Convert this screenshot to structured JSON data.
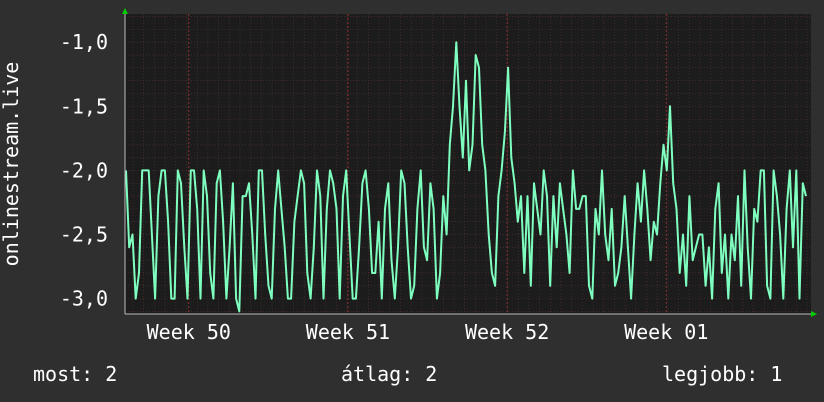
{
  "chart_data": {
    "type": "line",
    "ylabel": "onlinestream.live",
    "ylim": [
      -3.12,
      -0.78
    ],
    "yticks": [
      -1.0,
      -1.5,
      -2.0,
      -2.5,
      -3.0
    ],
    "ytick_labels": [
      "-1,0",
      "-1,5",
      "-2,0",
      "-2,5",
      "-3,0"
    ],
    "xtick_labels": [
      "Week 50",
      "Week 51",
      "Week 52",
      "Week 01"
    ],
    "xtick_positions": [
      0.093,
      0.325,
      0.557,
      0.789
    ],
    "grid": true,
    "colors": {
      "line": "#7fffbf",
      "background": "#2f2f2f",
      "plot_bg": "#1c1c1c",
      "grid": "#553333",
      "arrow": "#00cc00",
      "text": "#ffffff"
    },
    "series": [
      {
        "values": [
          -2,
          -2.6,
          -2.5,
          -3,
          -2.8,
          -2,
          -2,
          -2,
          -2.5,
          -3,
          -2.2,
          -2,
          -2,
          -2.4,
          -3,
          -3,
          -2,
          -2.1,
          -2.6,
          -3,
          -2,
          -2,
          -2.3,
          -3,
          -2,
          -2.2,
          -2.8,
          -3,
          -2.1,
          -2,
          -2.4,
          -3,
          -2.6,
          -2.1,
          -3,
          -3.1,
          -2.2,
          -2.2,
          -2.1,
          -2.5,
          -3,
          -2,
          -2,
          -2.5,
          -2.9,
          -3,
          -2.3,
          -2,
          -2.3,
          -2.6,
          -3,
          -3,
          -2.4,
          -2.2,
          -2,
          -2.1,
          -2.8,
          -3,
          -2.6,
          -2,
          -2.2,
          -3,
          -2.3,
          -2,
          -2.1,
          -2.3,
          -3,
          -2.2,
          -2,
          -2.5,
          -3,
          -3,
          -2.6,
          -2.1,
          -2,
          -2.3,
          -2.8,
          -2.8,
          -2.4,
          -3,
          -2.3,
          -2.1,
          -2.7,
          -3,
          -2.6,
          -2,
          -2.1,
          -2.6,
          -3,
          -2.9,
          -2.3,
          -2.0,
          -2.6,
          -2.7,
          -2.1,
          -2.3,
          -3,
          -2.8,
          -2.2,
          -2.5,
          -1.8,
          -1.5,
          -1.0,
          -1.5,
          -1.9,
          -1.3,
          -2.0,
          -1.8,
          -1.1,
          -1.2,
          -1.8,
          -2.0,
          -2.5,
          -2.8,
          -2.9,
          -2.2,
          -2,
          -1.7,
          -1.2,
          -1.9,
          -2.1,
          -2.4,
          -2.2,
          -2.8,
          -2.2,
          -2.9,
          -2.1,
          -2.3,
          -2.5,
          -2,
          -2.2,
          -2.9,
          -2.2,
          -2.6,
          -2.1,
          -2.3,
          -2.5,
          -2.8,
          -2,
          -2.3,
          -2.3,
          -2.2,
          -2.2,
          -2.9,
          -3,
          -2.3,
          -2.5,
          -2,
          -2.5,
          -2.7,
          -2.3,
          -2.9,
          -2.8,
          -2.6,
          -2.2,
          -2.6,
          -3,
          -2.5,
          -2.1,
          -2.4,
          -2,
          -2.3,
          -2.7,
          -2.4,
          -2.5,
          -2.1,
          -1.8,
          -2,
          -1.5,
          -2.1,
          -2.3,
          -2.8,
          -2.5,
          -2.9,
          -2.2,
          -2.7,
          -2.6,
          -2.5,
          -2.5,
          -2.9,
          -2.6,
          -3,
          -2.3,
          -2.1,
          -2.8,
          -2.5,
          -3,
          -2.5,
          -2.7,
          -2.2,
          -2.9,
          -2,
          -2.6,
          -3,
          -2.3,
          -2.4,
          -2,
          -2,
          -2.9,
          -3,
          -2,
          -2.2,
          -2.5,
          -3,
          -2.3,
          -2,
          -2.6,
          -2,
          -3,
          -2.1,
          -2.2
        ]
      }
    ]
  },
  "footer": {
    "current": "most: 2",
    "average": "átlag: 2",
    "best": "legjobb: 1"
  }
}
